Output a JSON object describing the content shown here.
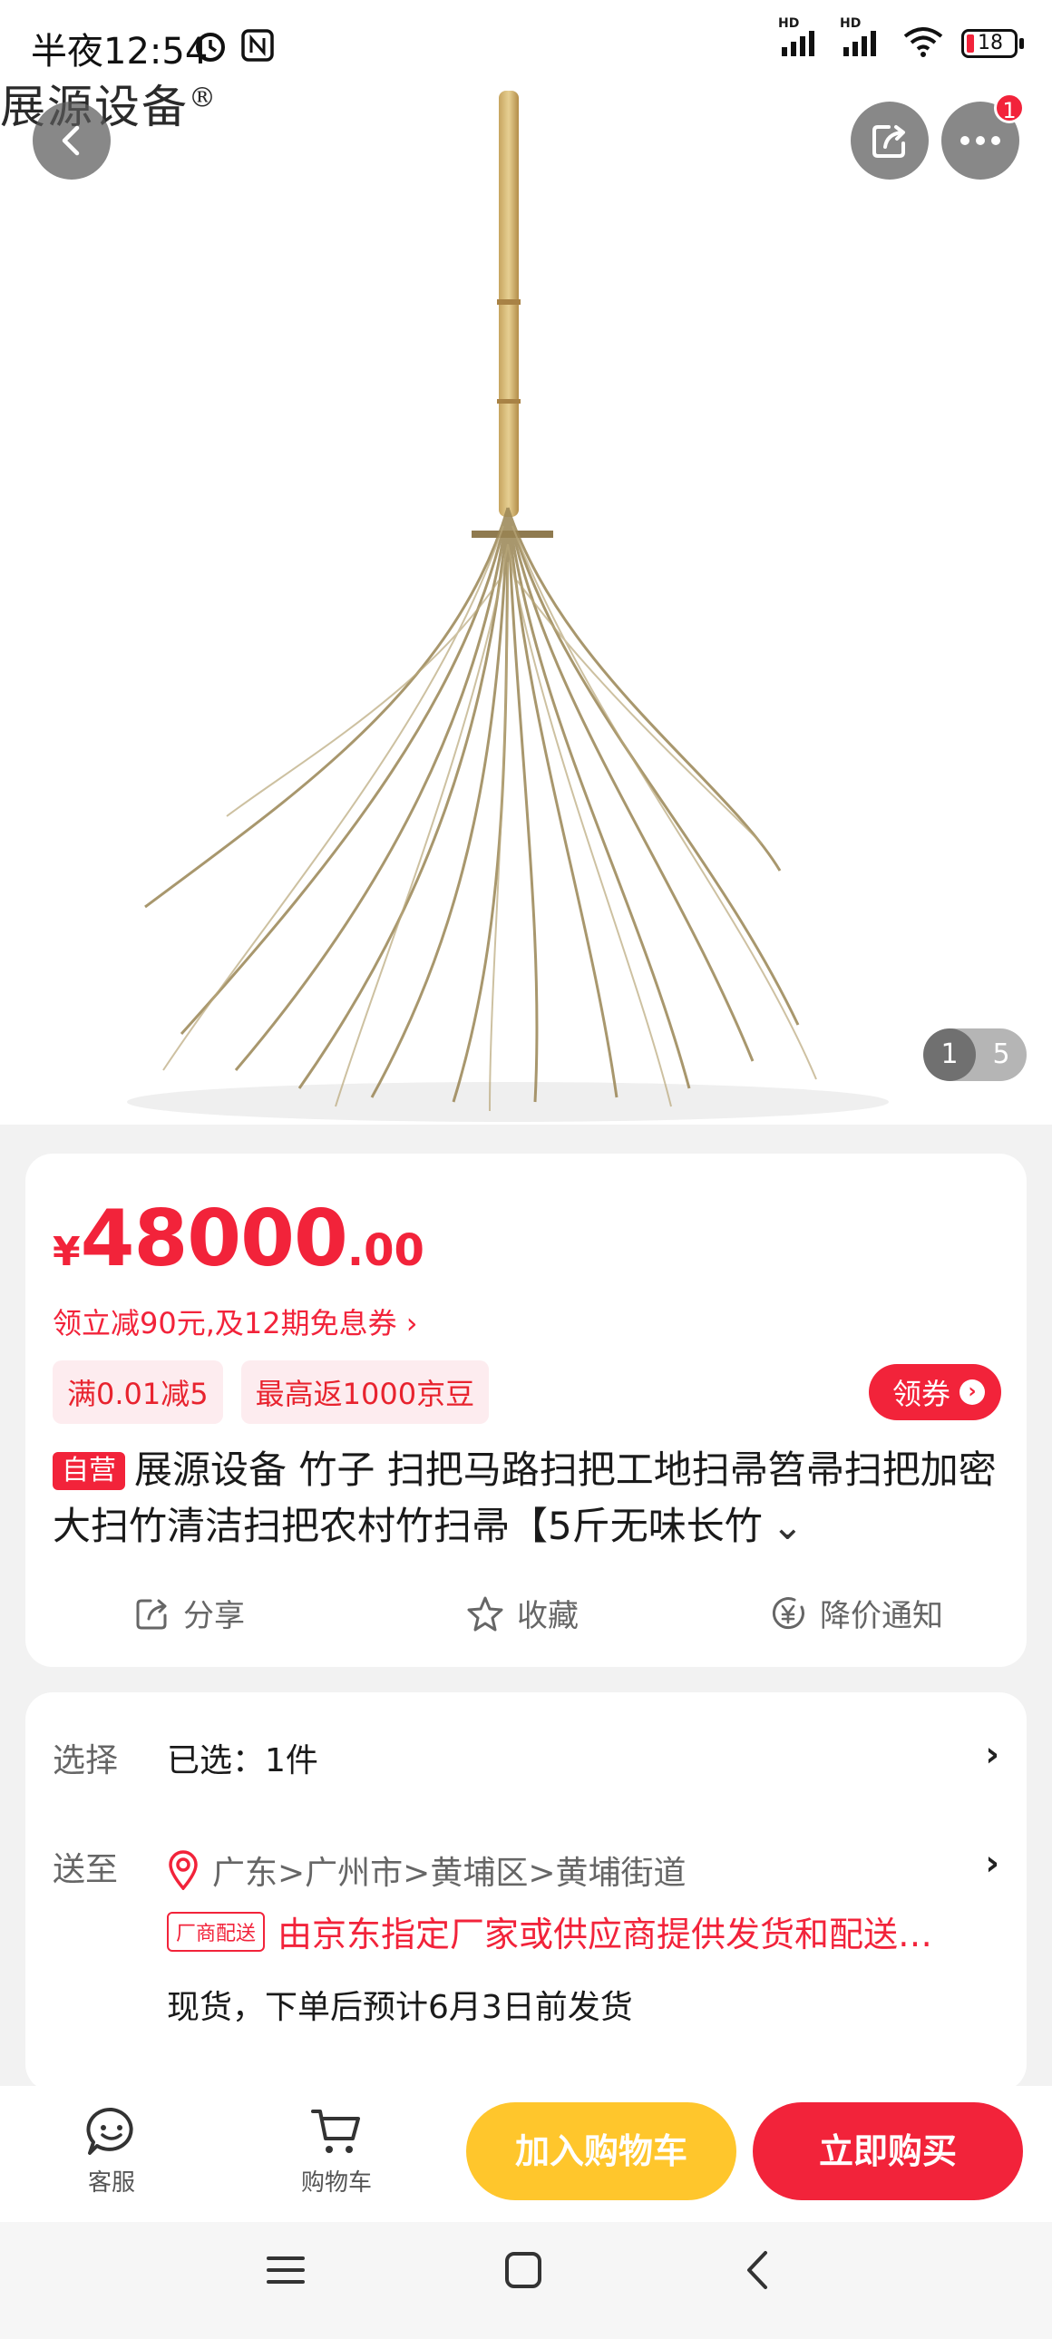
{
  "status_bar": {
    "time": "半夜12:54",
    "battery": "18",
    "net_label_1": "HD",
    "net_label_2": "HD"
  },
  "hero": {
    "brand_watermark": "展源设备",
    "brand_mark": "®",
    "more_badge": "1",
    "pager_current": "1",
    "pager_total": "5"
  },
  "price": {
    "currency": "¥",
    "integer": "48000",
    "decimal": ".00"
  },
  "promo": {
    "coupon_line": "领立减90元,及12期免息券 ›",
    "tags": [
      "满0.01减5",
      "最高返1000京豆"
    ],
    "get_coupon": "领券"
  },
  "product": {
    "self_operated_tag": "自营",
    "title": "展源设备 竹子 扫把马路扫把工地扫帚笤帚扫把加密大扫竹清洁扫把农村竹扫帚【5斤无味长竹",
    "expand": "⌄"
  },
  "actions": {
    "share": "分享",
    "favorite": "收藏",
    "price_alert": "降价通知"
  },
  "selection": {
    "select_label": "选择",
    "select_value": "已选：1件",
    "ship_label": "送至",
    "address": "广东>广州市>黄埔区>黄埔街道",
    "ship_tag": "厂商配送",
    "ship_text": "由京东指定厂家或供应商提供发货和配送…",
    "stock": "现货，下单后预计6月3日前发货",
    "chevron": "›"
  },
  "bottom_bar": {
    "service": "客服",
    "cart": "购物车",
    "add_to_cart": "加入购物车",
    "buy_now": "立即购买"
  },
  "colors": {
    "accent": "#f2233a",
    "cart_button": "#ffc62c"
  },
  "icons": [
    "back-icon",
    "share-icon",
    "more-icon",
    "share-outline-icon",
    "star-icon",
    "yen-circle-icon",
    "location-pin-icon",
    "smile-chat-icon",
    "cart-icon",
    "menu-icon",
    "home-square-icon",
    "nav-back-icon"
  ]
}
